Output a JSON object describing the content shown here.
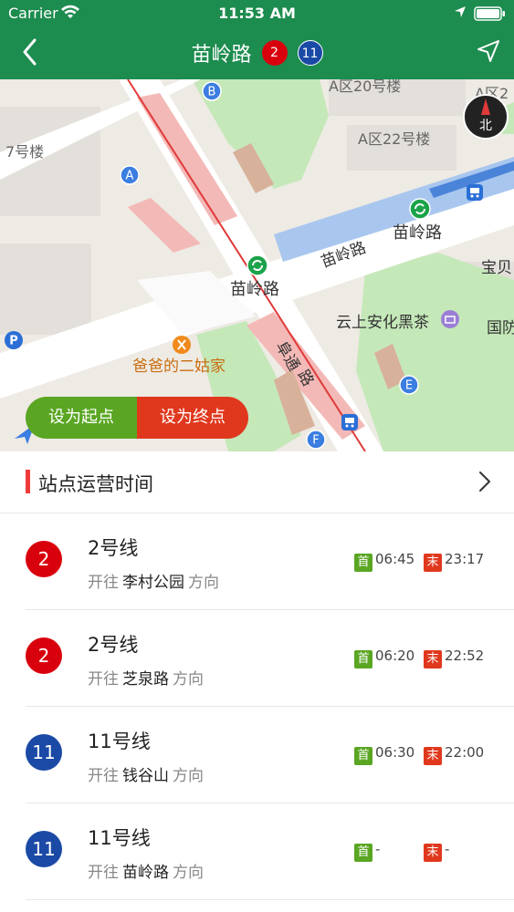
{
  "status_bar": {
    "carrier": "Carrier",
    "time": "11:53 AM"
  },
  "nav": {
    "title": "苗岭路",
    "badges": [
      "2",
      "11"
    ]
  },
  "map": {
    "labels": {
      "a_zone_20": "A区20号楼",
      "a_zone_2x": "A区2",
      "a_zone_22": "A区22号楼",
      "bldg_7": "7号楼",
      "station_right": "苗岭路",
      "road_miaoling": "苗岭路",
      "station_center": "苗岭路",
      "yunshang": "云上安化黑茶",
      "baobei": "宝贝",
      "guoji": "国防",
      "babade": "爸爸的二姑家",
      "futong": "阜通",
      "futong_2": "路",
      "compass": "北"
    },
    "exits": [
      "A",
      "B",
      "E",
      "F"
    ],
    "set_start": "设为起点",
    "set_end": "设为终点"
  },
  "ops": {
    "label": "站点运营时间"
  },
  "lines": [
    {
      "badge": "2",
      "color": "#d9000d",
      "name": "2号线",
      "prefix": "开往",
      "dest": "李村公园",
      "suffix": "方向",
      "first_tag": "首",
      "first": "06:45",
      "last_tag": "末",
      "last": "23:17"
    },
    {
      "badge": "2",
      "color": "#d9000d",
      "name": "2号线",
      "prefix": "开往",
      "dest": "芝泉路",
      "suffix": "方向",
      "first_tag": "首",
      "first": "06:20",
      "last_tag": "末",
      "last": "22:52"
    },
    {
      "badge": "11",
      "color": "#1b4aa6",
      "name": "11号线",
      "prefix": "开往",
      "dest": "钱谷山",
      "suffix": "方向",
      "first_tag": "首",
      "first": "06:30",
      "last_tag": "末",
      "last": "22:00"
    },
    {
      "badge": "11",
      "color": "#1b4aa6",
      "name": "11号线",
      "prefix": "开往",
      "dest": "苗岭路",
      "suffix": "方向",
      "first_tag": "首",
      "first": "-",
      "last_tag": "末",
      "last": "-"
    }
  ]
}
